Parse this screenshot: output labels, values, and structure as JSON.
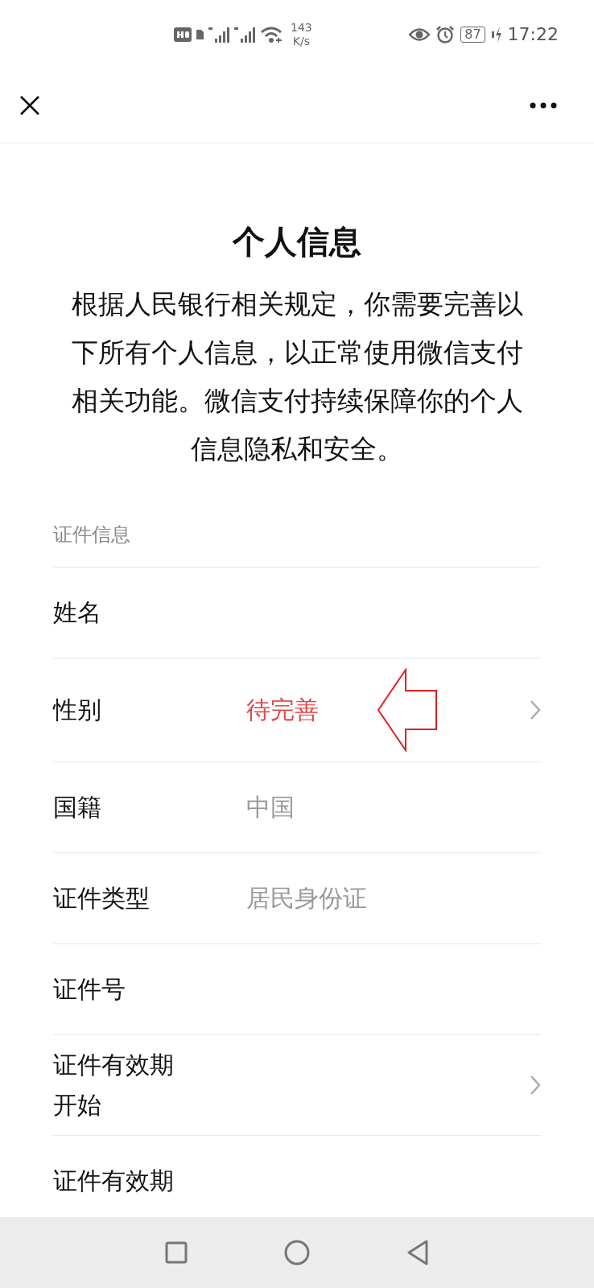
{
  "status_bar": {
    "speed": "143",
    "speed_unit": "K/s",
    "battery": "87",
    "time": "17:22"
  },
  "title": "个人信息",
  "intro": "根据人民银行相关规定，你需要完善以下所有个人信息，以正常使用微信支付相关功能。微信支付持续保障你的个人信息隐私和安全。",
  "section": {
    "label": "证件信息",
    "rows": [
      {
        "label": "姓名",
        "chevron": false
      },
      {
        "label": "性别",
        "value": "待完善",
        "kind": "pending",
        "chevron": true,
        "annotated": true
      },
      {
        "label": "国籍",
        "value": "中国",
        "kind": "filled",
        "chevron": false
      },
      {
        "label": "证件类型",
        "value": "居民身份证",
        "kind": "filled",
        "chevron": false
      },
      {
        "label": "证件号",
        "chevron": false
      },
      {
        "label": "证件有效期开始",
        "chevron": true
      },
      {
        "label": "证件有效期",
        "chevron": false
      }
    ]
  }
}
